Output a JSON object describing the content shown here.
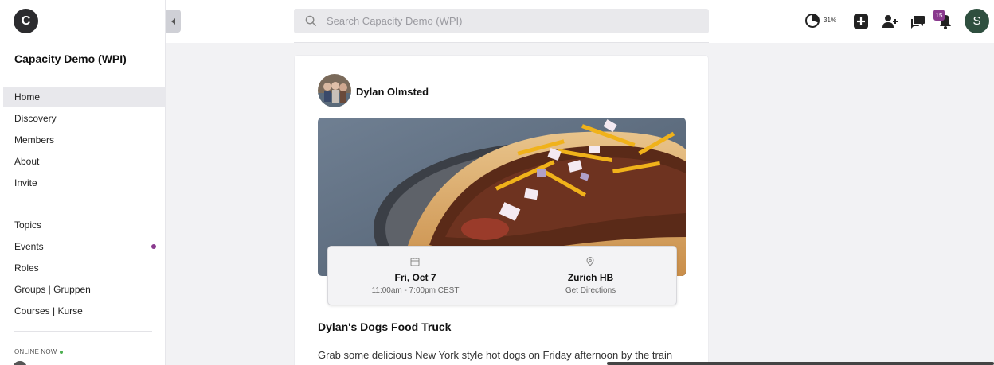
{
  "sidebar": {
    "logo_letter": "C",
    "community_name": "Capacity Demo (WPI)",
    "primary_items": [
      {
        "label": "Home"
      },
      {
        "label": "Discovery"
      },
      {
        "label": "Members"
      },
      {
        "label": "About"
      },
      {
        "label": "Invite"
      }
    ],
    "secondary_items": [
      {
        "label": "Topics"
      },
      {
        "label": "Events"
      },
      {
        "label": "Roles"
      },
      {
        "label": "Groups | Gruppen"
      },
      {
        "label": "Courses | Kurse"
      }
    ],
    "active_item": "Home",
    "online_now_label": "ONLINE NOW"
  },
  "topbar": {
    "search_placeholder": "Search Capacity Demo (WPI)",
    "progress_text": "31%",
    "progress_value": 0.31,
    "notification_count": "15",
    "user_initial": "S",
    "icons": [
      "progress-ring-icon",
      "add-icon",
      "add-user-icon",
      "chat-icon",
      "bell-icon"
    ]
  },
  "post": {
    "author": "Dylan Olmsted",
    "event": {
      "date": "Fri, Oct 7",
      "time": "11:00am - 7:00pm CEST",
      "location": "Zurich HB",
      "directions": "Get Directions"
    },
    "title": "Dylan's Dogs Food Truck",
    "body": "Grab some delicious New York style hot dogs on Friday afternoon by the train station!"
  },
  "colors": {
    "accent": "#8a3a8e",
    "user_avatar": "#2f4f3f",
    "online": "#4caf50"
  }
}
